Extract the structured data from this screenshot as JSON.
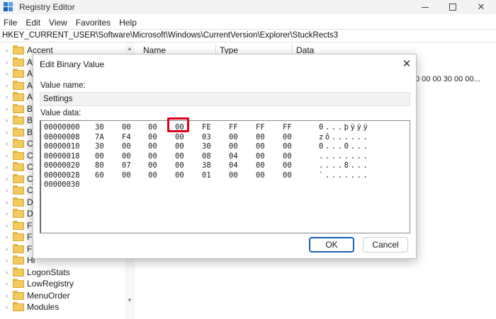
{
  "window": {
    "title": "Registry Editor",
    "minimize_glyph": "",
    "close_glyph": "✕"
  },
  "menu": [
    "File",
    "Edit",
    "View",
    "Favorites",
    "Help"
  ],
  "address": "HKEY_CURRENT_USER\\Software\\Microsoft\\Windows\\CurrentVersion\\Explorer\\StuckRects3",
  "tree": {
    "items": [
      {
        "label": "Accent"
      },
      {
        "label": "Ac"
      },
      {
        "label": "Ap"
      },
      {
        "label": "Au"
      },
      {
        "label": "Au"
      },
      {
        "label": "Ba"
      },
      {
        "label": "Ba"
      },
      {
        "label": "Bit"
      },
      {
        "label": "Ca"
      },
      {
        "label": "Cl"
      },
      {
        "label": "Cl"
      },
      {
        "label": "Cl"
      },
      {
        "label": "Co"
      },
      {
        "label": "De"
      },
      {
        "label": "Di"
      },
      {
        "label": "Fe"
      },
      {
        "label": "Fil"
      },
      {
        "label": "Fo"
      },
      {
        "label": "Hi"
      },
      {
        "label": "LogonStats"
      },
      {
        "label": "LowRegistry"
      },
      {
        "label": "MenuOrder"
      },
      {
        "label": "Modules"
      }
    ]
  },
  "list": {
    "columns": [
      "Name",
      "Type",
      "Data"
    ],
    "row_data": "0 00 00 30 00 00..."
  },
  "dialog": {
    "title": "Edit Binary Value",
    "close_glyph": "✕",
    "value_name_label": "Value name:",
    "value_name": "Settings",
    "value_data_label": "Value data:",
    "hex_rows": [
      {
        "addr": "00000000",
        "bytes": [
          "30",
          "00",
          "00",
          "00",
          "FE",
          "FF",
          "FF",
          "FF"
        ],
        "ascii": "0...þÿÿÿ"
      },
      {
        "addr": "00000008",
        "bytes": [
          "7A",
          "F4",
          "00",
          "00",
          "03",
          "00",
          "00",
          "00"
        ],
        "ascii": "zô......"
      },
      {
        "addr": "00000010",
        "bytes": [
          "30",
          "00",
          "00",
          "00",
          "30",
          "00",
          "00",
          "00"
        ],
        "ascii": "0...0..."
      },
      {
        "addr": "00000018",
        "bytes": [
          "00",
          "00",
          "00",
          "00",
          "08",
          "04",
          "00",
          "00"
        ],
        "ascii": "........"
      },
      {
        "addr": "00000020",
        "bytes": [
          "80",
          "07",
          "00",
          "00",
          "38",
          "04",
          "00",
          "00"
        ],
        "ascii": "....8..."
      },
      {
        "addr": "00000028",
        "bytes": [
          "60",
          "00",
          "00",
          "00",
          "01",
          "00",
          "00",
          "00"
        ],
        "ascii": "`......."
      },
      {
        "addr": "00000030",
        "bytes": [],
        "ascii": ""
      }
    ],
    "ok_label": "OK",
    "cancel_label": "Cancel"
  },
  "colors": {
    "highlight": "#e0001b",
    "default_button_border": "#1a5fb4"
  }
}
